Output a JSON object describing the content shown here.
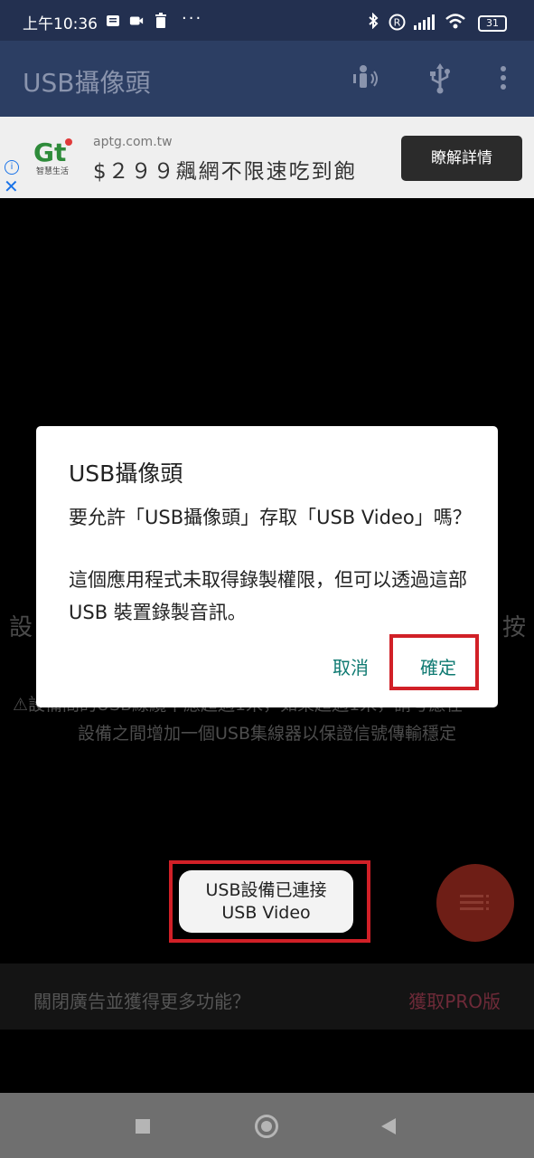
{
  "status_bar": {
    "time": "上午10:36",
    "battery": "31",
    "icons": [
      "notification-icon",
      "video-call-icon",
      "trash-icon",
      "more-dots-icon",
      "bluetooth-icon",
      "registered-icon",
      "signal-icon",
      "wifi-icon",
      "battery-icon"
    ]
  },
  "app_bar": {
    "title": "USB攝像頭",
    "icons": [
      "audio-person-icon",
      "usb-icon",
      "overflow-menu-icon"
    ]
  },
  "ad": {
    "logo_text": "智慧生活",
    "url": "aptg.com.tw",
    "headline": "$２９９飆網不限速吃到飽",
    "cta": "瞭解詳情",
    "info_symbol": "i",
    "close_symbol": "✕"
  },
  "background": {
    "left_char": "設",
    "right_char": "按",
    "warning_line1": "⚠設備間的USB線纜不應超過1米，如果超過1米，請考慮在",
    "warning_line2": "設備之間增加一個USB集線器以保證信號傳輸穩定"
  },
  "dialog": {
    "title": "USB攝像頭",
    "message1": "要允許「USB攝像頭」存取「USB Video」嗎？",
    "message2": "這個應用程式未取得錄製權限，但可以透過這部 USB 裝置錄製音訊。",
    "cancel": "取消",
    "ok": "確定"
  },
  "toast": {
    "line1": "USB設備已連接",
    "line2": "USB Video"
  },
  "pro_bar": {
    "text": "關閉廣告並獲得更多功能？",
    "get_pro": "獲取PRO版"
  },
  "colors": {
    "status_bar": "#233050",
    "app_bar": "#2c3e63",
    "accent_teal": "#0f7a72",
    "highlight_red": "#d12027",
    "fab": "#6e1e16"
  }
}
